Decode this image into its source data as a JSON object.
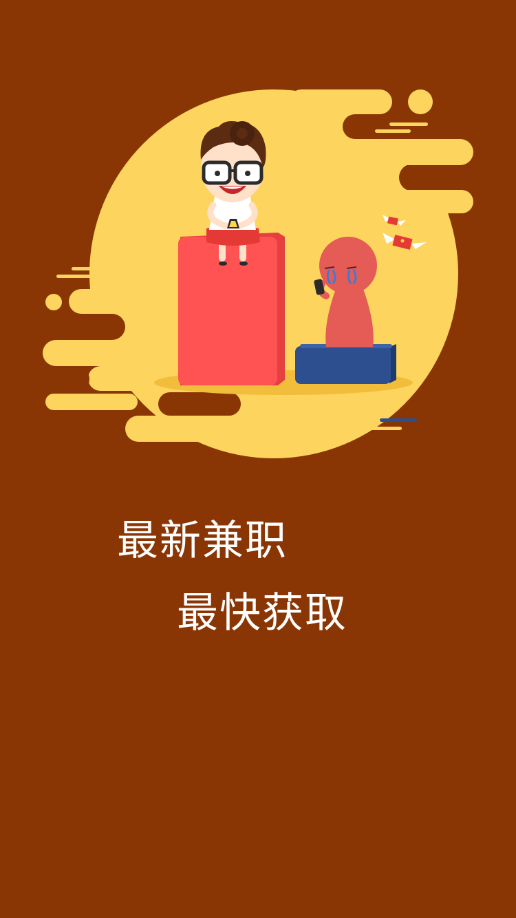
{
  "splash": {
    "headline_line_1": "最新兼职",
    "headline_line_2": "最快获取"
  },
  "illustration": {
    "description_icon": "splash-illustration",
    "colors": {
      "background": "#8a3604",
      "sun": "#fcd45e",
      "red_block": "#ff5252",
      "blue_block": "#2d4f8f",
      "sad_figure": "#e55b56"
    }
  }
}
